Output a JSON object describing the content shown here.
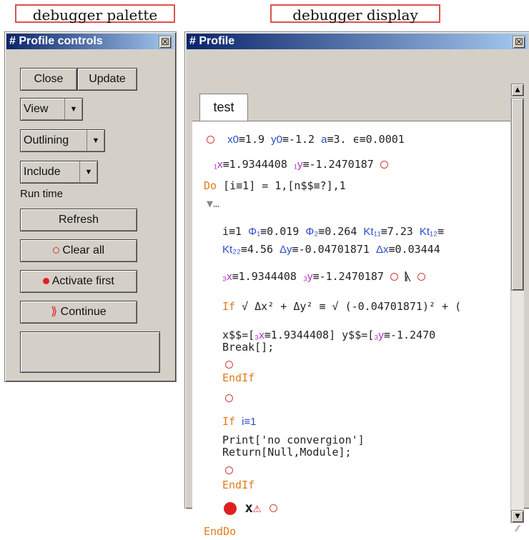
{
  "captions": {
    "palette": "debugger palette",
    "display": "debugger display"
  },
  "palette": {
    "title": "# Profile controls",
    "close_glyph": "☒",
    "close_label": "Close",
    "update_label": "Update",
    "view_label": "View",
    "outlining_label": "Outlining",
    "include_label": "Include",
    "dropdown_arrow": "▼",
    "run_time_label": "Run time",
    "refresh_label": "Refresh",
    "clear_all_label": "Clear all",
    "activate_first_label": "Activate first",
    "continue_label": "Continue",
    "continue_glyph": "⟫"
  },
  "display": {
    "title": "# Profile",
    "tab_label": "test",
    "lines": {
      "l1": {
        "x0": "x0",
        "x0v": "≡1.9",
        "y0": "y0",
        "y0v": "≡-1.2",
        "a": "a",
        "av": "≡3.",
        "eps": "ϵ≡0.0001"
      },
      "l2": {
        "x1": "₁x",
        "x1v": "≡1.9344408",
        "y1": "₁y",
        "y1v": "≡-1.2470187"
      },
      "l3": {
        "do": "Do",
        "rest": "[i≡1] = 1,[n$$≡?],1"
      },
      "l4": {
        "collapse": "▼…"
      },
      "l5": {
        "i": "i≡1",
        "phi1": "Φ₁",
        "phi1v": "≡0.019",
        "phi2": "Φ₂",
        "phi2v": "≡0.264",
        "kt11": "Kt₁₁",
        "kt11v": "≡7.23",
        "kt12": "Kt₁₂",
        "kt12v": "≡"
      },
      "l6": {
        "kt22": "Kt₂₂",
        "kt22v": "≡4.56",
        "dy": "Δy",
        "dyv": "≡-0.04701871",
        "dx": "Δx",
        "dxv": "≡0.03444"
      },
      "l7": {
        "x3": "₃x",
        "x3v": "≡1.9344408",
        "y3": "₃y",
        "y3v": "≡-1.2470187",
        "rune": "ᚣ"
      },
      "l8": {
        "kw": "If",
        "expr": "√ Δx² + Δy² ≡ √ (-0.04701871)² + ("
      },
      "l9": {
        "pre": "x$$=[",
        "x3": "₃x",
        "x3v": "≡1.9344408] y$$=[",
        "y3": "₃y",
        "y3v": "≡-1.2470"
      },
      "l10": {
        "text": "Break[];"
      },
      "l11": {
        "text": "EndIf"
      },
      "l12": {
        "kw": "If",
        "rest": "i≡1"
      },
      "l13": {
        "text": "Print['no convergion']"
      },
      "l14": {
        "text": "Return[Null,Module];"
      },
      "l15": {
        "text": "EndIf"
      },
      "l16": {
        "x": "x",
        "warn": "⚠"
      },
      "l17": {
        "text": "EndDo"
      }
    },
    "scroll_up": "▲",
    "scroll_down": "▼",
    "resize_grip": "⁄⁄"
  }
}
